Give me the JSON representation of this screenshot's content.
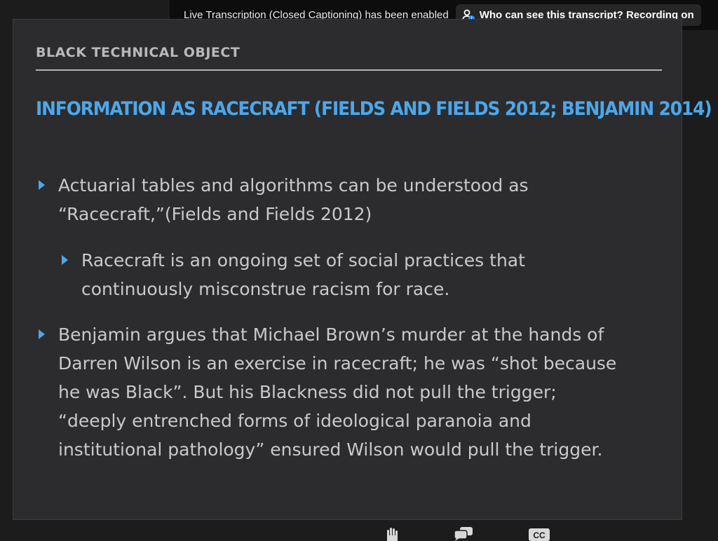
{
  "banner": {
    "message": "Live Transcription (Closed Captioning) has been enabled",
    "button_label": "Who can see this transcript? Recording on"
  },
  "slide": {
    "header": "BLACK TECHNICAL OBJECT",
    "title": "INFORMATION AS RACECRAFT (FIELDS AND FIELDS 2012; BENJAMIN 2014)",
    "bullets": [
      {
        "lines": [
          "Actuarial tables and algorithms can be understood as",
          "“Racecraft,”(Fields and Fields 2012)"
        ]
      },
      {
        "lines": [
          "Racecraft is an ongoing set of social practices that",
          "continuously misconstrue racism for race."
        ]
      },
      {
        "lines": [
          "Benjamin argues that Michael Brown’s murder at the hands of",
          "Darren Wilson is an exercise in racecraft; he was “shot because",
          "he was Black”.  But his Blackness did not pull the trigger;",
          "“deeply entrenched forms of ideological paranoia and",
          "institutional pathology” ensured Wilson would pull the trigger."
        ]
      }
    ]
  },
  "toolbar": {
    "cc_label": "CC",
    "icons": [
      "raise-hand-icon",
      "chat-icon",
      "closed-caption-icon"
    ]
  },
  "colors": {
    "accent": "#4ca7ea",
    "slide_bg": "#2c2c2e",
    "body_text": "#c9c9c9"
  }
}
